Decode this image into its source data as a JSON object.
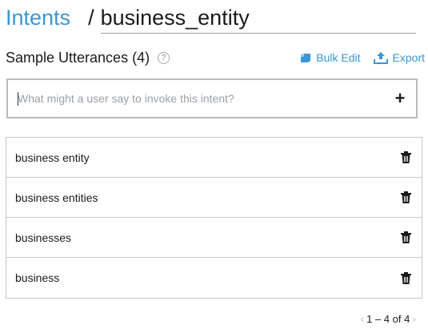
{
  "breadcrumb": {
    "parent": "Intents",
    "separator": "/",
    "current": "business_entity"
  },
  "section": {
    "title": "Sample Utterances (4)",
    "help_icon": "?",
    "actions": {
      "bulk_edit": "Bulk Edit",
      "export": "Export"
    }
  },
  "input": {
    "placeholder": "What might a user say to invoke this intent?",
    "value": "",
    "add_label": "+"
  },
  "utterances": [
    "business entity",
    "business entities",
    "businesses",
    "business"
  ],
  "pager": {
    "prev": "‹",
    "text": "1 – 4 of 4",
    "next": "›"
  },
  "colors": {
    "accent": "#3b96d6",
    "border": "#c8c8c8"
  }
}
